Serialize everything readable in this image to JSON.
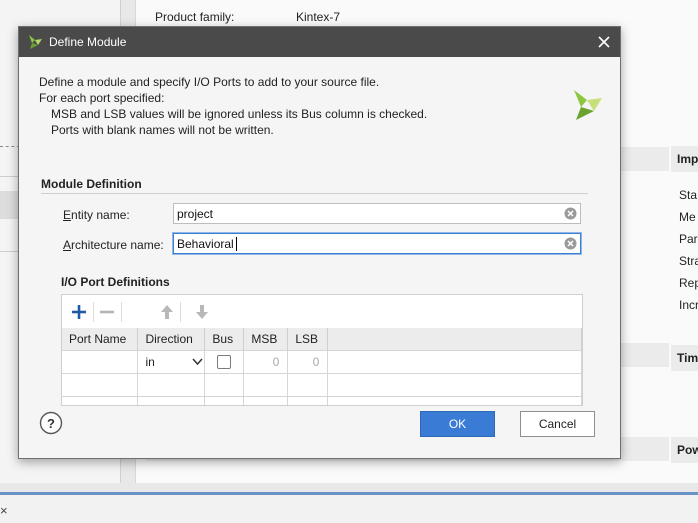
{
  "background": {
    "top_row": {
      "label": "Product family:",
      "value": "Kintex-7"
    },
    "right_panel": {
      "headers": [
        "Imp",
        "Tim",
        "Pow"
      ],
      "items": [
        "Sta",
        "Me",
        "Par",
        "Stra",
        "Rep",
        "Incr"
      ]
    },
    "bottom_close": "×"
  },
  "dialog": {
    "title": "Define Module",
    "close_icon": "close-icon",
    "description": {
      "line1": "Define a module and specify I/O Ports to add to your source file.",
      "line2": "For each port specified:",
      "line3": "MSB and LSB values will be ignored unless its Bus column is checked.",
      "line4": "Ports with blank names will not be written."
    },
    "module_definition": {
      "section_title": "Module Definition",
      "entity_label_first": "E",
      "entity_label_rest": "ntity name:",
      "entity_value": "project",
      "architecture_label_first": "A",
      "architecture_label_rest": "rchitecture name:",
      "architecture_value": "Behavioral"
    },
    "io_ports": {
      "section_title": "I/O Port Definitions",
      "toolbar_icons": [
        "plus-icon",
        "minus-icon",
        "arrow-up-icon",
        "arrow-down-icon"
      ],
      "columns": [
        "Port Name",
        "Direction",
        "Bus",
        "MSB",
        "LSB"
      ],
      "rows": [
        {
          "port_name": "",
          "direction": "in",
          "bus": false,
          "msb": "0",
          "lsb": "0"
        }
      ]
    },
    "buttons": {
      "ok": "OK",
      "cancel": "Cancel",
      "help": "?"
    },
    "accent_color": "#3a7bd5",
    "logo_color": "#8dc63f"
  }
}
